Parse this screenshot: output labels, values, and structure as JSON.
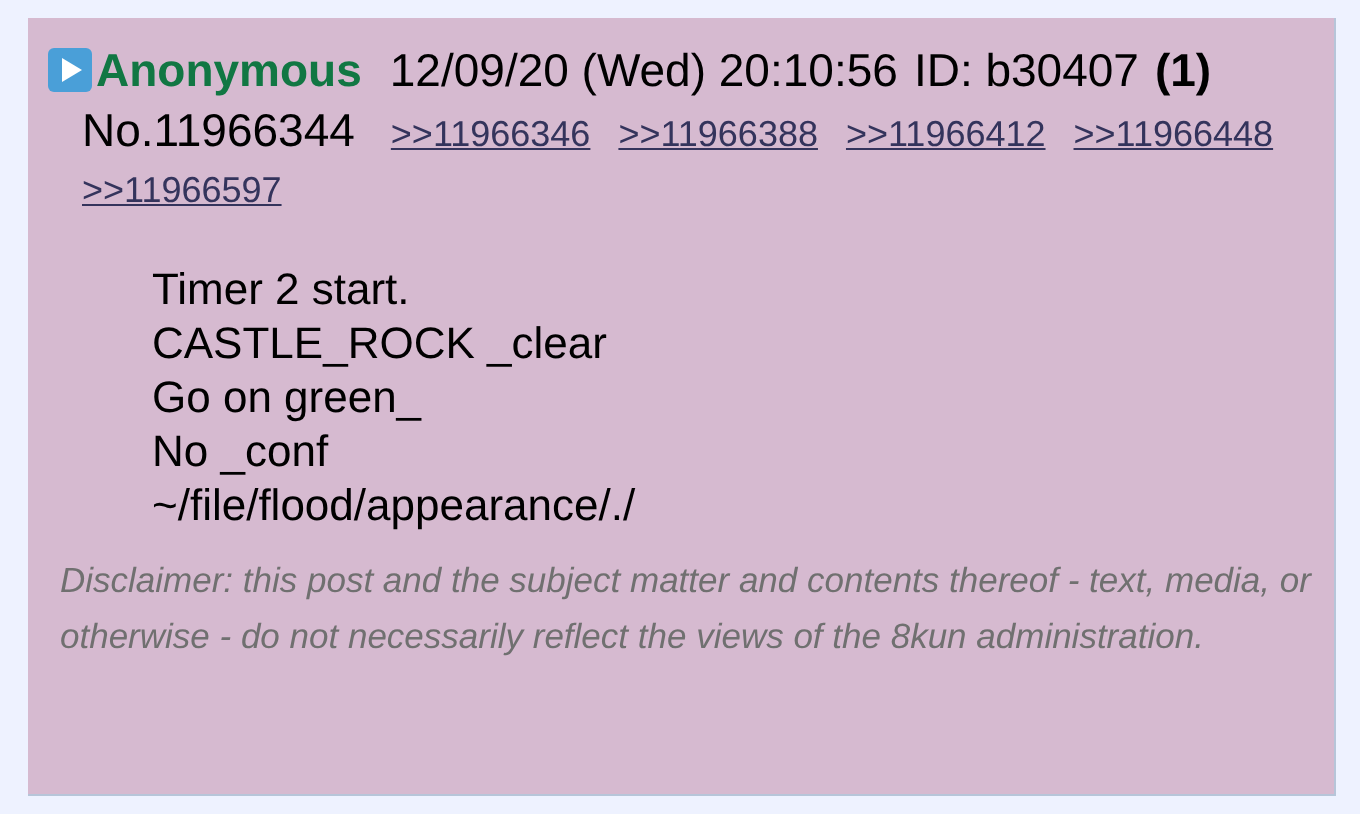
{
  "post": {
    "name": "Anonymous",
    "date": "12/09/20 (Wed) 20:10:56",
    "id_label": "ID: b30407",
    "id_count": "(1)",
    "number": "No.11966344",
    "replies": [
      ">>11966346",
      ">>11966388",
      ">>11966412",
      ">>11966448",
      ">>11966597"
    ],
    "body": [
      "Timer 2 start.",
      "CASTLE_ROCK _clear",
      "Go on green_",
      "No _conf",
      "~/file/flood/appearance/./"
    ],
    "disclaimer": "Disclaimer: this post and the subject matter and contents thereof - text, media, or otherwise - do not necessarily reflect the views of the 8kun administration."
  }
}
